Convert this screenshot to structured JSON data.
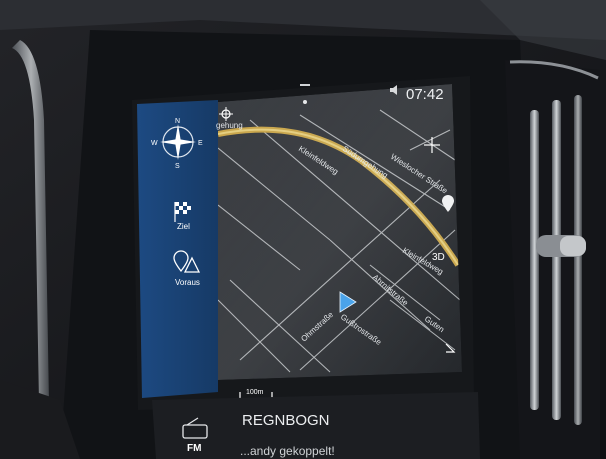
{
  "status": {
    "time": "07:42",
    "volume_icon": "speaker-icon",
    "indicator_icon": "dot-icon"
  },
  "sidebar": {
    "compass_letters": {
      "n": "N",
      "s": "S",
      "w": "W",
      "e": "E"
    },
    "items": [
      {
        "label": "Ziel",
        "icon": "checkered-flag-icon"
      },
      {
        "label": "Voraus",
        "icon": "location-warning-icon"
      }
    ]
  },
  "map": {
    "view_mode": "3D",
    "scale": "100m",
    "streets": [
      "Kleinfeldweg",
      "Südumgehung",
      "Wieslocher Straße",
      "Kleinfeldweg",
      "Ahrnitstraße",
      "Ohmstraße",
      "Gußtrostraße",
      "Guten"
    ],
    "top_left_partial": "gehung",
    "colors": {
      "route": "#c8a54a",
      "position": "#4aa3ea",
      "sidebar": "#1f4d86"
    }
  },
  "media": {
    "source": "FM",
    "station": "REGNBOGN",
    "message": "...andy gekoppelt!"
  }
}
